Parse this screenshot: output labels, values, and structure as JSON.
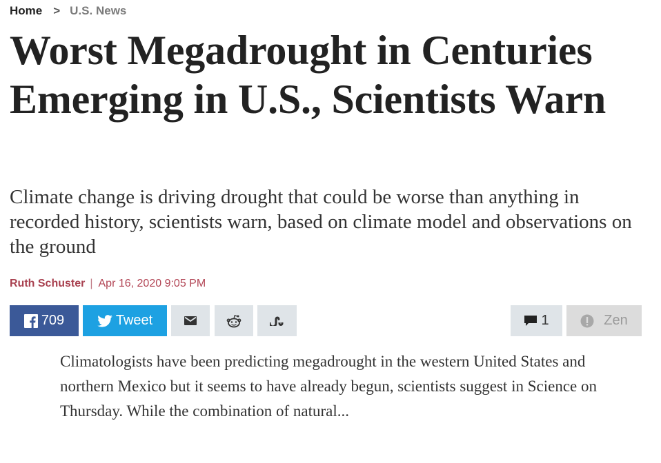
{
  "breadcrumb": {
    "home": "Home",
    "separator": ">",
    "section": "U.S. News"
  },
  "article": {
    "headline": "Worst Megadrought in Centuries Emerging in U.S., Scientists Warn",
    "subhead": "Climate change is driving drought that could be worse than anything in recorded history, scientists warn, based on climate model and observations on the ground",
    "author": "Ruth Schuster",
    "byline_separator": "|",
    "date": "Apr 16, 2020 9:05 PM",
    "excerpt": "Climatologists have been predicting megadrought in the western United States and northern Mexico but it seems to have already begun, scientists suggest in Science on Thursday. While the combination of natural..."
  },
  "share_bar": {
    "facebook": {
      "icon": "facebook-icon",
      "count": "709"
    },
    "twitter": {
      "icon": "twitter-bird-icon",
      "label": "Tweet"
    },
    "email": {
      "icon": "envelope-icon"
    },
    "reddit": {
      "icon": "reddit-icon"
    },
    "stumbleupon": {
      "icon": "stumbleupon-icon"
    },
    "comments": {
      "icon": "comment-bubble-icon",
      "count": "1"
    },
    "zen": {
      "icon": "zen-info-icon",
      "label": "Zen"
    }
  },
  "colors": {
    "facebook": "#3b5998",
    "twitter": "#1da1e2",
    "author": "#a8404f",
    "neutral_button": "#dfe4e8"
  }
}
